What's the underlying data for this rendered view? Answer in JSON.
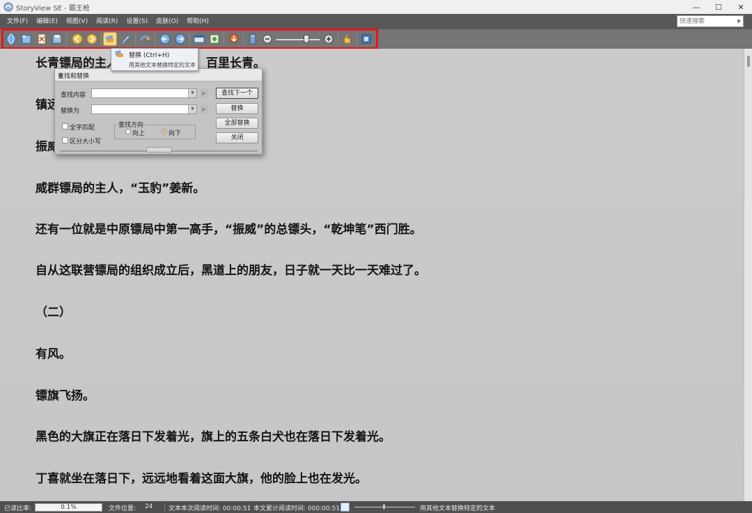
{
  "window": {
    "title": "StoryView SE - 霸王枪",
    "controls": [
      "—",
      "☐",
      "✕"
    ]
  },
  "menu": [
    "文件(F)",
    "编辑(E)",
    "视图(V)",
    "阅读(R)",
    "设置(S)",
    "皮肤(O)",
    "帮助(H)"
  ],
  "quick_search": {
    "placeholder": "快速搜索"
  },
  "toolbar": {
    "buttons": [
      "open-web-icon",
      "open-folder-icon",
      "close-file-icon",
      "save-icon",
      "prev-icon",
      "next-icon",
      "replace-icon",
      "brush-icon",
      "rotate-icon",
      "back-icon",
      "forward-icon",
      "screen-icon",
      "bookmark-icon",
      "download-icon",
      "book-icon",
      "zoom-out-icon",
      "zoom-in-icon",
      "hand-icon",
      "info-icon"
    ],
    "zoom_level": 0.63
  },
  "tooltip": {
    "title": "替换 (Ctrl+H)",
    "description": "用其他文本替换特定的文本"
  },
  "content": {
    "paragraphs": [
      "长青镖局的主人，",
      "百里长青。",
      "镇远",
      "振威",
      "威群镖局的主人，“玉豹”姜新。",
      "还有一位就是中原镖局中第一高手，“振威”的总镖头，“乾坤笔”西门胜。",
      "自从这联营镖局的组织成立后，黑道上的朋友，日子就一天比一天难过了。",
      "（二）",
      "有风。",
      "镖旗飞扬。",
      "黑色的大旗正在落日下发着光，旗上的五条白犬也在落日下发着光。",
      "丁喜就坐在落日下，远远地看着这面大旗，他的脸上也在发光。"
    ]
  },
  "dialog": {
    "title": "查找和替换",
    "find_label": "查找内容",
    "replace_label": "替换为",
    "find_value": "",
    "replace_value": "",
    "whole_word": "全字匹配",
    "match_case": "区分大小写",
    "direction_title": "查找方向",
    "up": "向上",
    "down": "向下",
    "btn_find_next": "查找下一个",
    "btn_replace": "替换",
    "btn_replace_all": "全部替换",
    "btn_close": "关闭"
  },
  "status": {
    "read_ratio_label": "已读比率:",
    "read_ratio": "0.1%",
    "file_pos_label": "文件位置:",
    "file_pos": "24",
    "session_time": "文本本次阅读时间: 00:00:51",
    "total_time": "本文累计阅读时间: 000:00:51",
    "hint": "用其他文本替换特定的文本"
  },
  "colors": {
    "menubar": "#585858",
    "toolbar": "#757575",
    "highlight": "#e8141a",
    "content_bg": "#c9c9c9",
    "text": "#141414"
  }
}
